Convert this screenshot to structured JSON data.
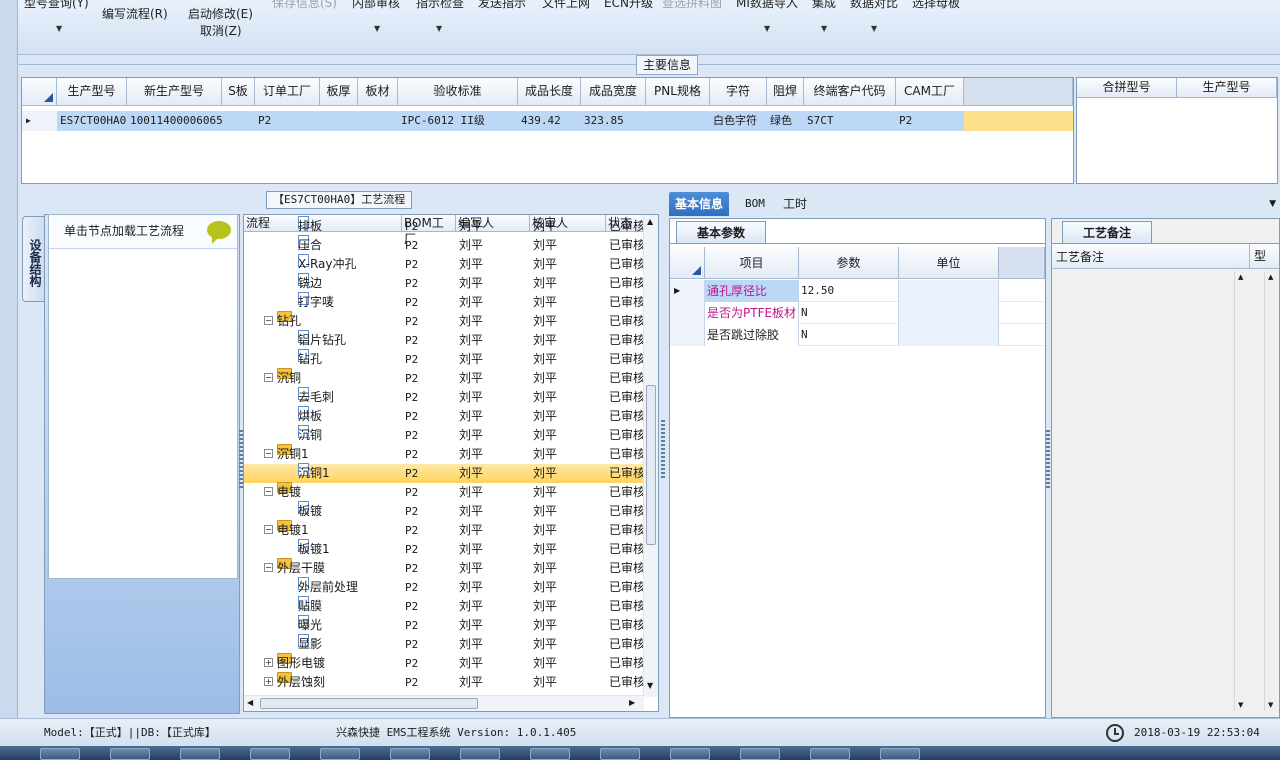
{
  "ribbon": {
    "buttons": [
      {
        "label": "型号查询(Y)",
        "dim": false
      },
      {
        "label": "编写流程(R)",
        "dim": false
      },
      {
        "label": "启动修改(E)",
        "dim": false
      },
      {
        "label": "取消(Z)",
        "dim": false
      },
      {
        "label": "保存信息(S)",
        "dim": true
      },
      {
        "label": "内部审核",
        "dim": false
      },
      {
        "label": "指示检查",
        "dim": false
      },
      {
        "label": "发送指示",
        "dim": false
      },
      {
        "label": "文件上网",
        "dim": false
      },
      {
        "label": "ECN升级",
        "dim": false
      },
      {
        "label": "查选拼料图",
        "dim": true
      },
      {
        "label": "MI数据导入",
        "dim": false
      },
      {
        "label": "集成",
        "dim": false
      },
      {
        "label": "数据对比",
        "dim": false
      },
      {
        "label": "选择母板",
        "dim": false
      }
    ]
  },
  "main_info": {
    "group_title": "主要信息",
    "columns": [
      "生产型号",
      "新生产型号",
      "S板",
      "订单工厂",
      "板厚",
      "板材",
      "验收标准",
      "成品长度",
      "成品宽度",
      "PNL规格",
      "字符",
      "阻焊",
      "终端客户代码",
      "CAM工厂"
    ],
    "row": [
      "ES7CT00HA0",
      "10011400006065",
      "",
      "P2",
      "",
      "",
      "IPC-6012 II级",
      "439.42",
      "323.85",
      "",
      "白色字符",
      "绿色",
      "S7CT",
      "P2"
    ],
    "side_columns": [
      "合拼型号",
      "生产型号"
    ]
  },
  "process": {
    "panel_title": "【ES7CT00HA0】工艺流程",
    "side_tab": "设备结构",
    "node_hint": "单击节点加载工艺流程",
    "columns": [
      "流程",
      "BOM工厂",
      "编写人",
      "核审人",
      "状态"
    ],
    "rows": [
      {
        "name": "排板",
        "level": 2,
        "type": "doc",
        "bom": "P2",
        "writer": "刘平",
        "reviewer": "刘平",
        "status": "已审核"
      },
      {
        "name": "压合",
        "level": 2,
        "type": "doc",
        "bom": "P2",
        "writer": "刘平",
        "reviewer": "刘平",
        "status": "已审核"
      },
      {
        "name": "X-Ray冲孔",
        "level": 2,
        "type": "doc",
        "bom": "P2",
        "writer": "刘平",
        "reviewer": "刘平",
        "status": "已审核"
      },
      {
        "name": "铣边",
        "level": 2,
        "type": "doc",
        "bom": "P2",
        "writer": "刘平",
        "reviewer": "刘平",
        "status": "已审核"
      },
      {
        "name": "打字唛",
        "level": 2,
        "type": "doc",
        "bom": "P2",
        "writer": "刘平",
        "reviewer": "刘平",
        "status": "已审核"
      },
      {
        "name": "钻孔",
        "level": 1,
        "type": "folder",
        "bom": "P2",
        "writer": "刘平",
        "reviewer": "刘平",
        "status": "已审核"
      },
      {
        "name": "铝片钻孔",
        "level": 2,
        "type": "doc",
        "bom": "P2",
        "writer": "刘平",
        "reviewer": "刘平",
        "status": "已审核"
      },
      {
        "name": "钻孔",
        "level": 2,
        "type": "doc",
        "bom": "P2",
        "writer": "刘平",
        "reviewer": "刘平",
        "status": "已审核"
      },
      {
        "name": "沉铜",
        "level": 1,
        "type": "folder",
        "bom": "P2",
        "writer": "刘平",
        "reviewer": "刘平",
        "status": "已审核"
      },
      {
        "name": "去毛刺",
        "level": 2,
        "type": "doc",
        "bom": "P2",
        "writer": "刘平",
        "reviewer": "刘平",
        "status": "已审核"
      },
      {
        "name": "烘板",
        "level": 2,
        "type": "doc",
        "bom": "P2",
        "writer": "刘平",
        "reviewer": "刘平",
        "status": "已审核"
      },
      {
        "name": "沉铜",
        "level": 2,
        "type": "doc",
        "bom": "P2",
        "writer": "刘平",
        "reviewer": "刘平",
        "status": "已审核"
      },
      {
        "name": "沉铜1",
        "level": 1,
        "type": "folder",
        "bom": "P2",
        "writer": "刘平",
        "reviewer": "刘平",
        "status": "已审核"
      },
      {
        "name": "沉铜1",
        "level": 2,
        "type": "doc",
        "bom": "P2",
        "writer": "刘平",
        "reviewer": "刘平",
        "status": "已审核",
        "selected": true
      },
      {
        "name": "电镀",
        "level": 1,
        "type": "folder",
        "bom": "P2",
        "writer": "刘平",
        "reviewer": "刘平",
        "status": "已审核"
      },
      {
        "name": "板镀",
        "level": 2,
        "type": "doc",
        "bom": "P2",
        "writer": "刘平",
        "reviewer": "刘平",
        "status": "已审核"
      },
      {
        "name": "电镀1",
        "level": 1,
        "type": "folder",
        "bom": "P2",
        "writer": "刘平",
        "reviewer": "刘平",
        "status": "已审核"
      },
      {
        "name": "板镀1",
        "level": 2,
        "type": "doc",
        "bom": "P2",
        "writer": "刘平",
        "reviewer": "刘平",
        "status": "已审核"
      },
      {
        "name": "外层干膜",
        "level": 1,
        "type": "folder",
        "bom": "P2",
        "writer": "刘平",
        "reviewer": "刘平",
        "status": "已审核"
      },
      {
        "name": "外层前处理",
        "level": 2,
        "type": "doc",
        "bom": "P2",
        "writer": "刘平",
        "reviewer": "刘平",
        "status": "已审核"
      },
      {
        "name": "贴膜",
        "level": 2,
        "type": "doc",
        "bom": "P2",
        "writer": "刘平",
        "reviewer": "刘平",
        "status": "已审核"
      },
      {
        "name": "曝光",
        "level": 2,
        "type": "doc",
        "bom": "P2",
        "writer": "刘平",
        "reviewer": "刘平",
        "status": "已审核"
      },
      {
        "name": "显影",
        "level": 2,
        "type": "doc",
        "bom": "P2",
        "writer": "刘平",
        "reviewer": "刘平",
        "status": "已审核"
      },
      {
        "name": "图形电镀",
        "level": 1,
        "type": "folder",
        "collapsed": true,
        "bom": "P2",
        "writer": "刘平",
        "reviewer": "刘平",
        "status": "已审核"
      },
      {
        "name": "外层蚀刻",
        "level": 1,
        "type": "folder",
        "collapsed": true,
        "bom": "P2",
        "writer": "刘平",
        "reviewer": "刘平",
        "status": "已审核"
      }
    ]
  },
  "detail": {
    "tabs": [
      "基本信息",
      "BOM",
      "工时"
    ],
    "sub_tab": "基本参数",
    "columns": [
      "项目",
      "参数",
      "单位"
    ],
    "rows": [
      {
        "item": "通孔厚径比",
        "value": "12.50",
        "unit": "",
        "highlight": true
      },
      {
        "item": "是否为PTFE板材",
        "value": "N",
        "unit": "",
        "highlight": true
      },
      {
        "item": "是否跳过除胶",
        "value": "N",
        "unit": "",
        "highlight": false
      }
    ],
    "memo_tab": "工艺备注",
    "memo_columns": [
      "工艺备注",
      "型"
    ]
  },
  "status": {
    "left": "Model:【正式】||DB:【正式库】",
    "center": "兴森快捷 EMS工程系统 Version: 1.0.1.405",
    "datetime": "2018-03-19 22:53:04"
  },
  "colors": {
    "accent": "#2f6fc0",
    "selection": "#ffd35c",
    "highlight_text": "#c0168c"
  }
}
